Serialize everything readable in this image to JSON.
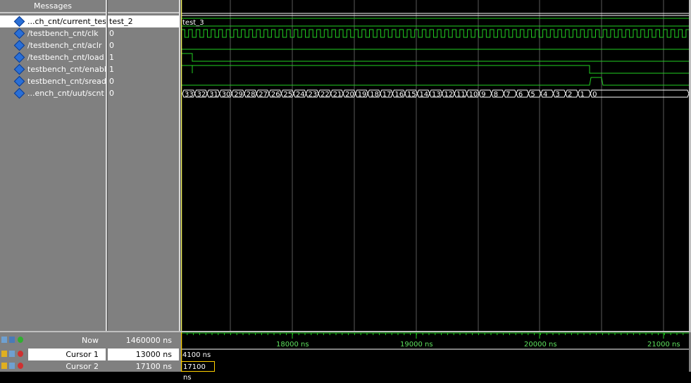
{
  "header": {
    "messages_label": "Messages"
  },
  "signals": [
    {
      "name": "...ch_cnt/current_test",
      "value": "test_2",
      "selected": true
    },
    {
      "name": "/testbench_cnt/clk",
      "value": "0"
    },
    {
      "name": "/testbench_cnt/aclr",
      "value": "0"
    },
    {
      "name": "/testbench_cnt/load",
      "value": "1"
    },
    {
      "name": "testbench_cnt/enable",
      "value": "1"
    },
    {
      "name": "testbench_cnt/sready",
      "value": "0"
    },
    {
      "name": "...ench_cnt/uut/scnt",
      "value": "0"
    }
  ],
  "waves": {
    "current_test_label": "test_3",
    "scnt_values": [
      "33",
      "32",
      "31",
      "30",
      "29",
      "28",
      "27",
      "26",
      "25",
      "24",
      "23",
      "22",
      "21",
      "20",
      "19",
      "18",
      "17",
      "16",
      "15",
      "14",
      "13",
      "12",
      "11",
      "10",
      "9",
      "8",
      "7",
      "6",
      "5",
      "4",
      "3",
      "2",
      "1",
      "0"
    ]
  },
  "timeline": {
    "tick_labels": [
      "18000 ns",
      "19000 ns",
      "20000 ns",
      "21000 ns"
    ]
  },
  "status": {
    "now_label": "Now",
    "now_value": "1460000 ns",
    "cursor1_label": "Cursor 1",
    "cursor1_value": "13000 ns",
    "cursor1_delta": "4100 ns",
    "cursor2_label": "Cursor 2",
    "cursor2_value": "17100 ns",
    "cursor2_box": "17100 ns"
  },
  "colors": {
    "wave": "#22d022",
    "grid": "#5a5a5a",
    "cursor": "#ffff66",
    "selection": "#ffffff",
    "diamond": "#2a6fd6"
  }
}
